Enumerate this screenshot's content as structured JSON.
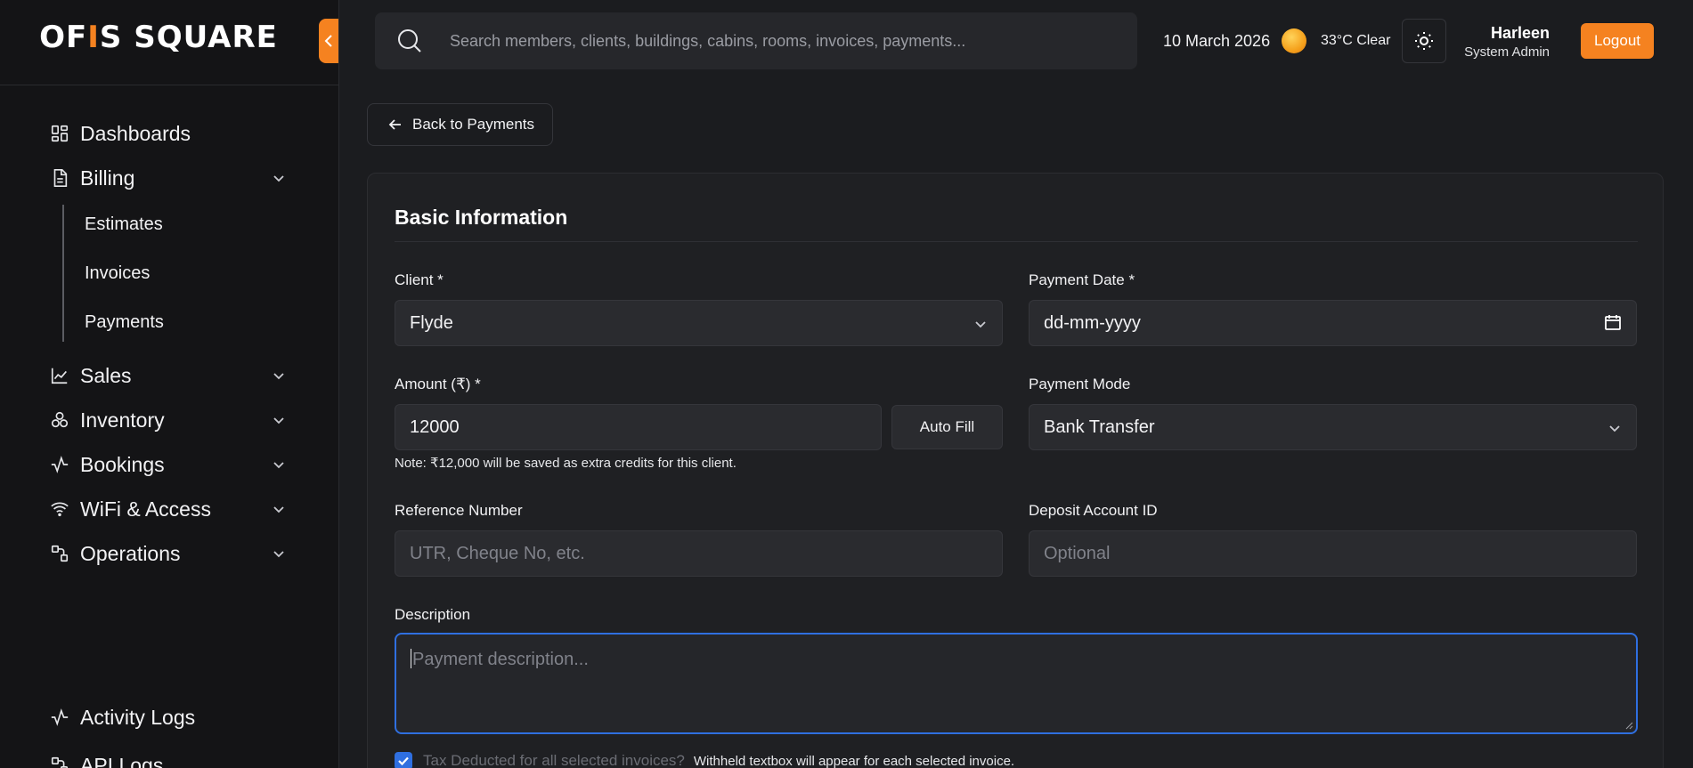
{
  "brand": {
    "logo_text_1": "OF",
    "logo_text_2": "I",
    "logo_text_3": "S SQUARE",
    "accent_color": "#f58220"
  },
  "sidebar": {
    "items": [
      {
        "label": "Dashboards"
      },
      {
        "label": "Billing"
      },
      {
        "label": "Sales"
      },
      {
        "label": "Inventory"
      },
      {
        "label": "Bookings"
      },
      {
        "label": "WiFi & Access"
      },
      {
        "label": "Operations"
      },
      {
        "label": "Activity Logs"
      },
      {
        "label": "API Logs"
      }
    ],
    "billing_sub": [
      {
        "label": "Estimates"
      },
      {
        "label": "Invoices"
      },
      {
        "label": "Payments"
      }
    ]
  },
  "topbar": {
    "search_placeholder": "Search members, clients, buildings, cabins, rooms, invoices, payments...",
    "date": "10 March 2026",
    "weather": "33°C Clear",
    "user_name": "Harleen",
    "user_role": "System Admin",
    "logout_label": "Logout"
  },
  "page": {
    "back_label": "Back to Payments",
    "section_title": "Basic Information",
    "client_label": "Client *",
    "client_value": "Flyde",
    "payment_date_label": "Payment Date *",
    "payment_date_placeholder": "dd-mm-yyyy",
    "amount_label": "Amount (₹) *",
    "amount_value": "12000",
    "autofill_label": "Auto Fill",
    "payment_mode_label": "Payment Mode",
    "payment_mode_value": "Bank Transfer",
    "amount_note": "Note: ₹12,000 will be saved as extra credits for this client.",
    "reference_label": "Reference Number",
    "reference_placeholder": "UTR, Cheque No, etc.",
    "deposit_label": "Deposit Account ID",
    "deposit_placeholder": "Optional",
    "description_label": "Description",
    "description_placeholder": "Payment description...",
    "tax_label": "Tax Deducted for all selected invoices?",
    "tax_hint": "Withheld textbox will appear for each selected invoice."
  }
}
